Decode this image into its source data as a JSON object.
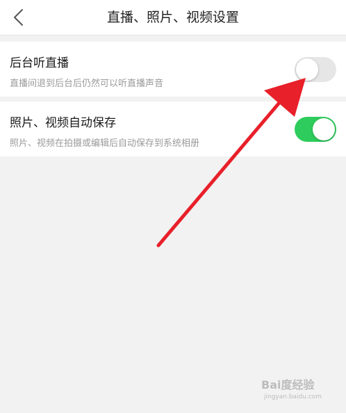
{
  "header": {
    "back_icon": "chevron-left-icon",
    "title": "直播、照片、视频设置"
  },
  "settings": [
    {
      "title": "后台听直播",
      "description": "直播间退到后台后仍然可以听直播声音",
      "enabled": false
    },
    {
      "title": "照片、视频自动保存",
      "description": "照片、视频在拍摄或编辑后自动保存到系统相册",
      "enabled": true
    }
  ],
  "colors": {
    "toggle_on": "#2ecc5c",
    "toggle_off": "#e6e6e6",
    "annotation_arrow": "#e8202a"
  },
  "watermark": {
    "logo": "Bai度经验",
    "sub": "jingyan.baidu.com"
  }
}
